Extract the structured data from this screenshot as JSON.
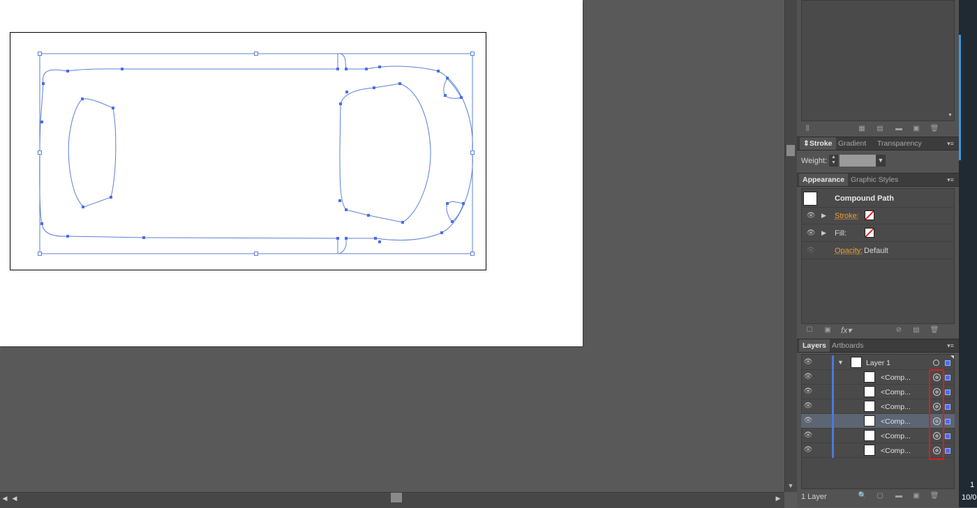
{
  "stroke_panel": {
    "tabs": [
      "Stroke",
      "Gradient",
      "Transparency"
    ],
    "weight_label": "Weight:",
    "weight_value": ""
  },
  "appearance_panel": {
    "tabs": [
      "Appearance",
      "Graphic Styles"
    ],
    "object_type": "Compound Path",
    "stroke_label": "Stroke:",
    "fill_label": "Fill:",
    "opacity_label": "Opacity:",
    "opacity_value": "Default",
    "fx_label": "fx"
  },
  "layers_panel": {
    "tabs": [
      "Layers",
      "Artboards"
    ],
    "layer_name": "Layer 1",
    "sublayers": [
      "<Comp...",
      "<Comp...",
      "<Comp...",
      "<Comp...",
      "<Comp...",
      "<Comp..."
    ],
    "selected_sublayer_index": 3,
    "status": "1 Layer"
  },
  "colors": {
    "selection_blue": "#4a6cf0",
    "path_blue": "#5b80d6",
    "highlight_red": "#e01b1b",
    "accent_orange": "#f0a030"
  },
  "dock_text": [
    "1",
    "10/0"
  ]
}
